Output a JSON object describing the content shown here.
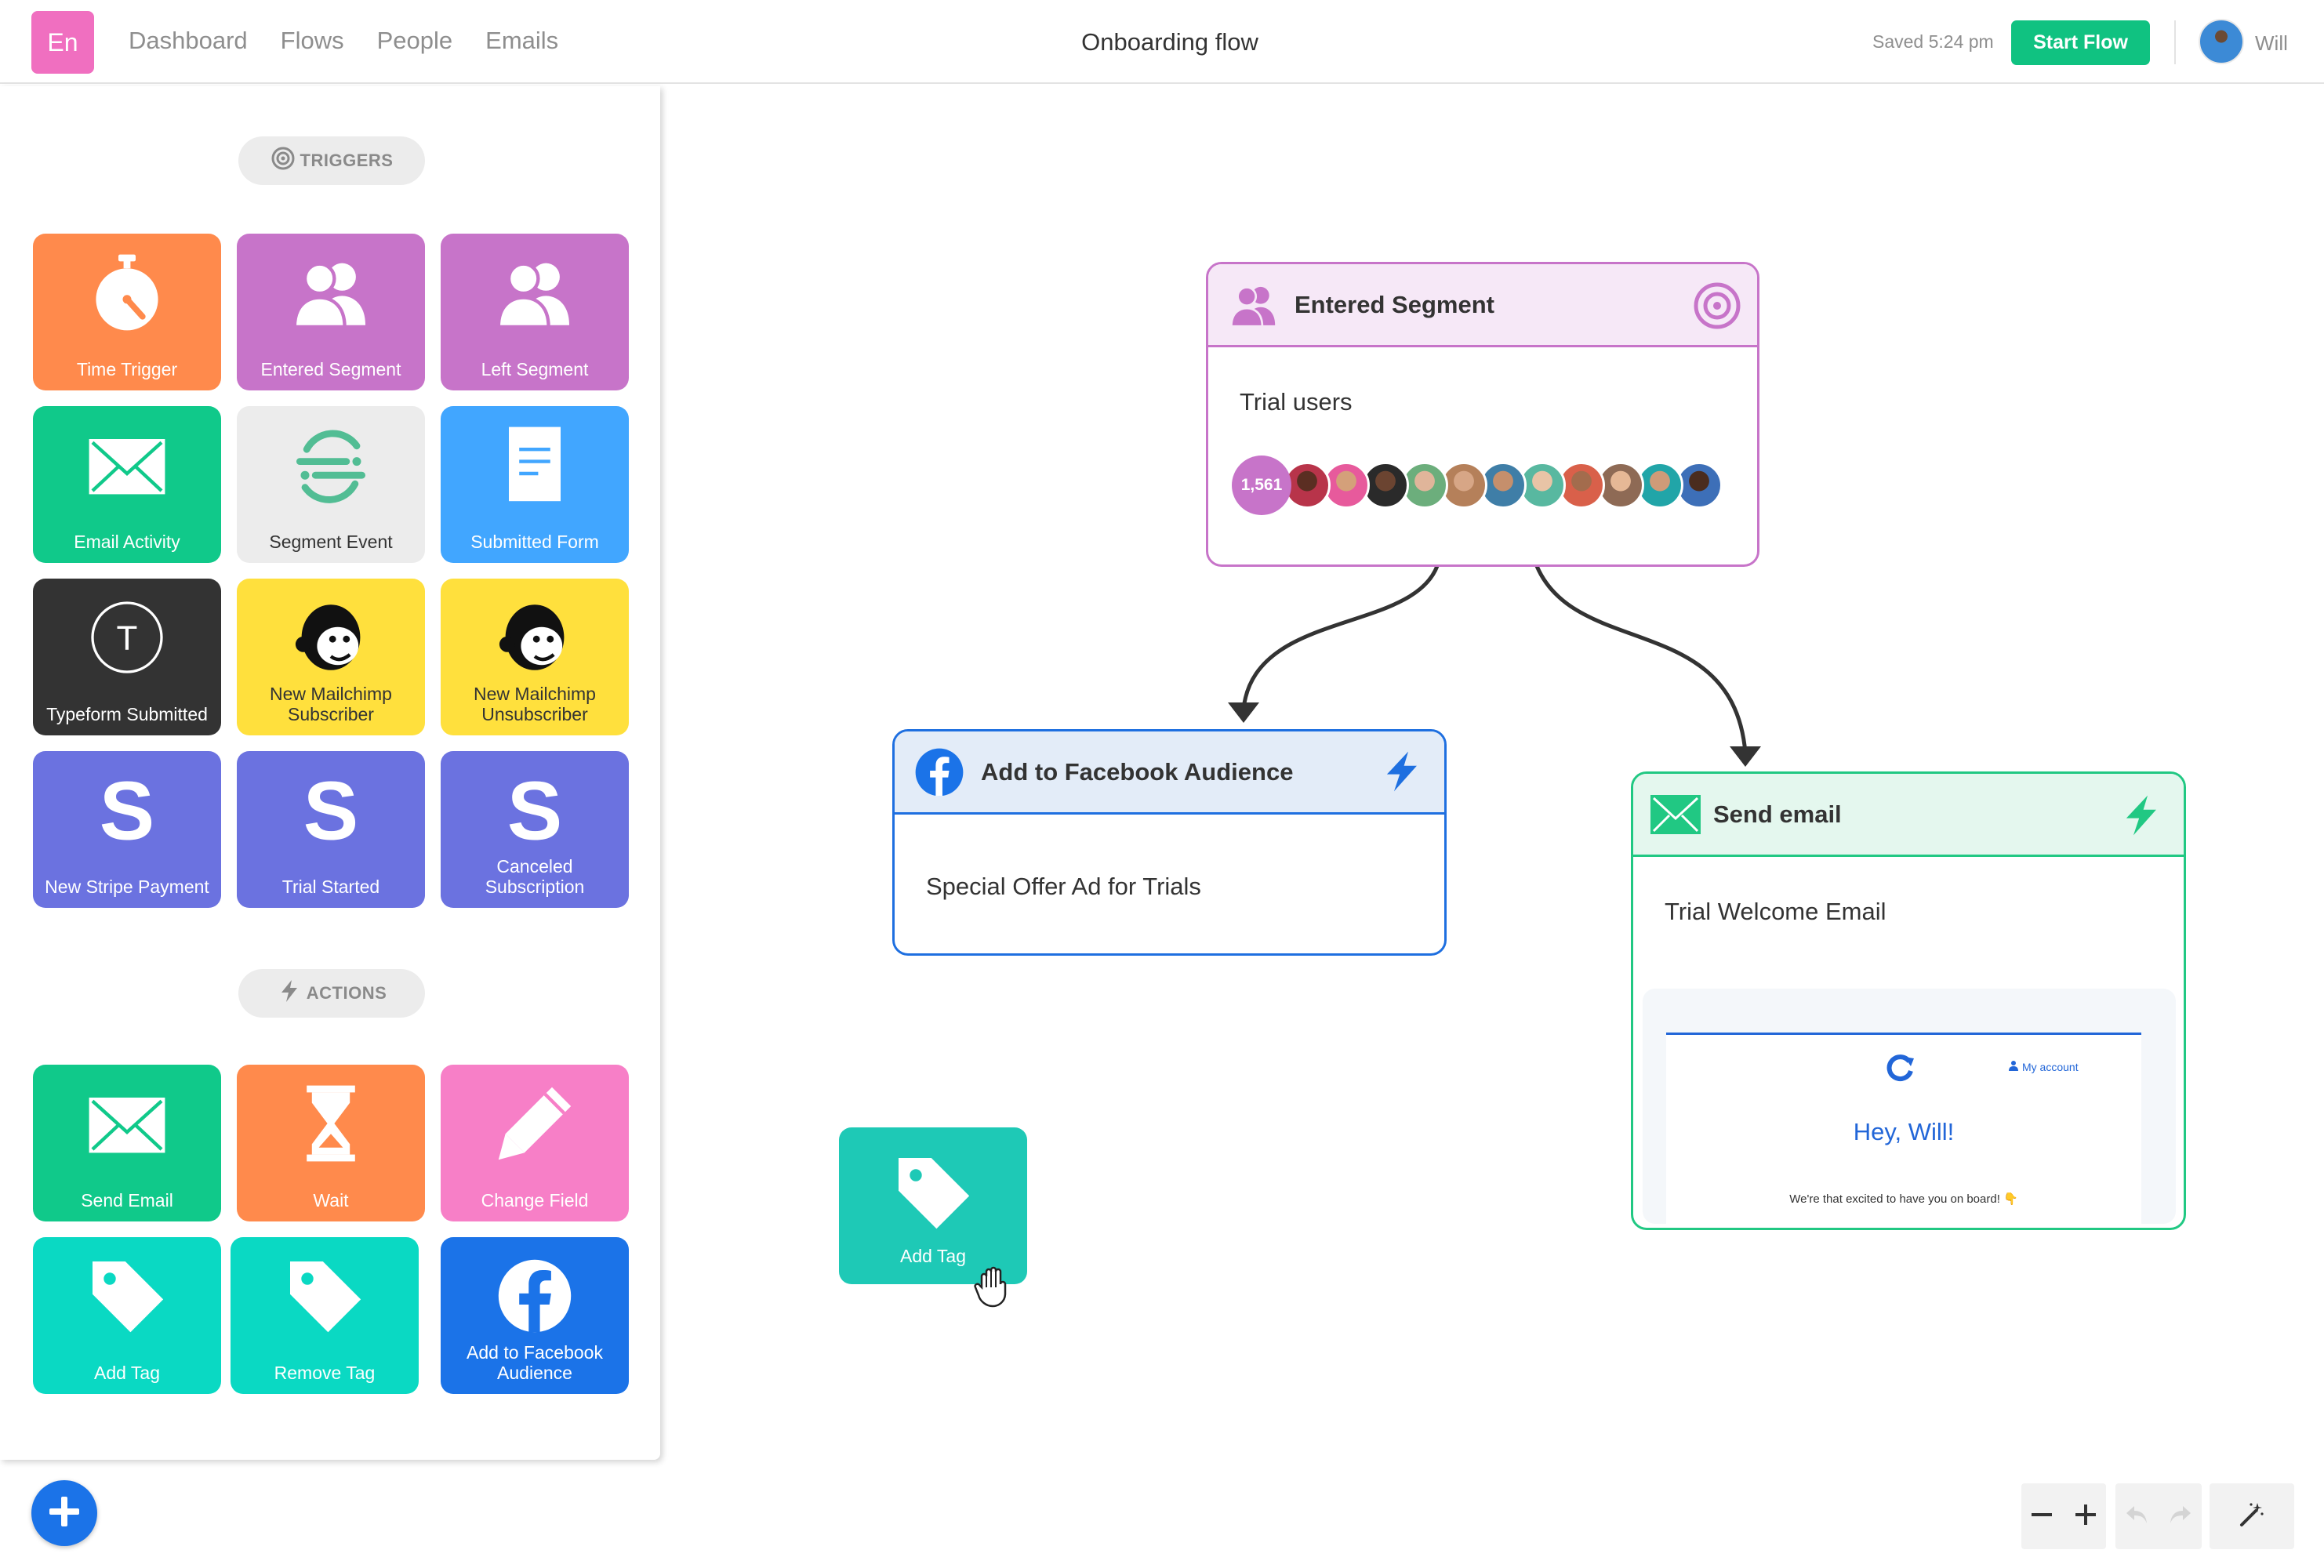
{
  "header": {
    "logo_text": "En",
    "nav": [
      "Dashboard",
      "Flows",
      "People",
      "Emails"
    ],
    "title": "Onboarding flow",
    "saved_text": "Saved 5:24 pm",
    "start_button": "Start Flow",
    "user_name": "Will"
  },
  "sidebar": {
    "triggers_label": "TRIGGERS",
    "actions_label": "ACTIONS",
    "triggers": [
      {
        "label": "Time Trigger",
        "icon": "stopwatch-icon",
        "color": "#ff8a4c"
      },
      {
        "label": "Entered Segment",
        "icon": "users-icon",
        "color": "#c774c9"
      },
      {
        "label": "Left Segment",
        "icon": "users-icon",
        "color": "#c774c9"
      },
      {
        "label": "Email Activity",
        "icon": "envelope-icon",
        "color": "#10c98a"
      },
      {
        "label": "Segment Event",
        "icon": "segment-logo-icon",
        "color": "#ececec"
      },
      {
        "label": "Submitted Form",
        "icon": "form-icon",
        "color": "#41a6ff"
      },
      {
        "label": "Typeform Submitted",
        "icon": "typeform-logo-icon",
        "color": "#333333"
      },
      {
        "label": "New Mailchimp Subscriber",
        "icon": "mailchimp-logo-icon",
        "color": "#ffe03d"
      },
      {
        "label": "New Mailchimp Unsubscriber",
        "icon": "mailchimp-logo-icon",
        "color": "#ffe03d"
      },
      {
        "label": "New Stripe Payment",
        "icon": "stripe-logo-icon",
        "color": "#6b72e0"
      },
      {
        "label": "Trial Started",
        "icon": "stripe-logo-icon",
        "color": "#6b72e0"
      },
      {
        "label": "Canceled Subscription",
        "icon": "stripe-logo-icon",
        "color": "#6b72e0"
      }
    ],
    "actions": [
      {
        "label": "Send Email",
        "icon": "envelope-icon",
        "color": "#10c98a"
      },
      {
        "label": "Wait",
        "icon": "hourglass-icon",
        "color": "#ff8a4c"
      },
      {
        "label": "Change Field",
        "icon": "pencil-icon",
        "color": "#f77fc7"
      },
      {
        "label": "Add Tag",
        "icon": "tag-icon",
        "color": "#0ad9c3"
      },
      {
        "label": "Remove Tag",
        "icon": "tag-icon",
        "color": "#0ad9c3"
      },
      {
        "label": "Add to Facebook Audience",
        "icon": "facebook-icon",
        "color": "#1b73e8"
      }
    ]
  },
  "canvas": {
    "segment_node": {
      "title": "Entered Segment",
      "body": "Trial users",
      "count": "1,561"
    },
    "facebook_node": {
      "title": "Add to Facebook Audience",
      "body": "Special Offer Ad for Trials"
    },
    "email_node": {
      "title": "Send email",
      "body": "Trial Welcome Email",
      "preview_account": "My account",
      "preview_greeting": "Hey, Will!",
      "preview_text": "We're that excited to have you on board! 👇"
    },
    "dragged_tile": {
      "label": "Add Tag",
      "icon": "tag-icon"
    }
  },
  "colors": {
    "brand": "#f06fc0",
    "start_button": "#10c281",
    "segment": "#c774c9",
    "facebook": "#1e6fe0",
    "email": "#21c883"
  }
}
